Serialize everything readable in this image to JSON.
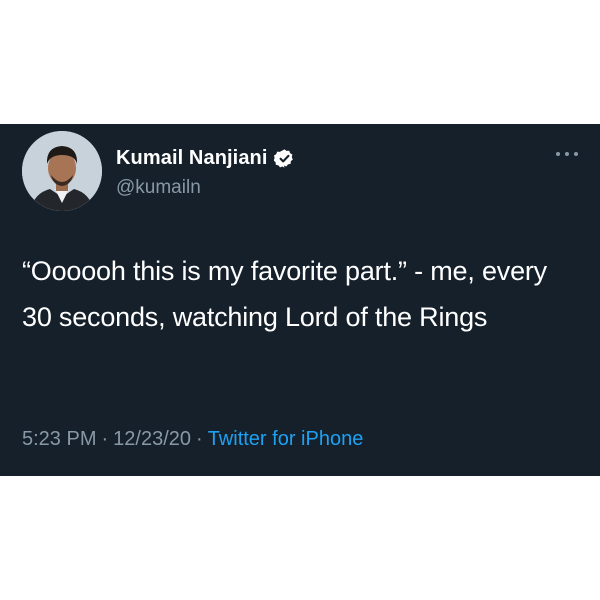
{
  "tweet": {
    "author": {
      "display_name": "Kumail Nanjiani",
      "handle": "@kumailn",
      "verified": true,
      "avatar_icon": "profile-photo"
    },
    "more_icon": "more-dots-icon",
    "text": "“Oooooh this is my favorite part.” - me, every 30 seconds, watching Lord of the Rings",
    "time": "5:23 PM",
    "separator": "·",
    "date": "12/23/20",
    "source": "Twitter for iPhone"
  },
  "colors": {
    "card_background": "#15202b",
    "primary_text": "#ffffff",
    "secondary_text": "#8899a6",
    "link": "#1da1f2",
    "verified_badge": "#ffffff"
  }
}
